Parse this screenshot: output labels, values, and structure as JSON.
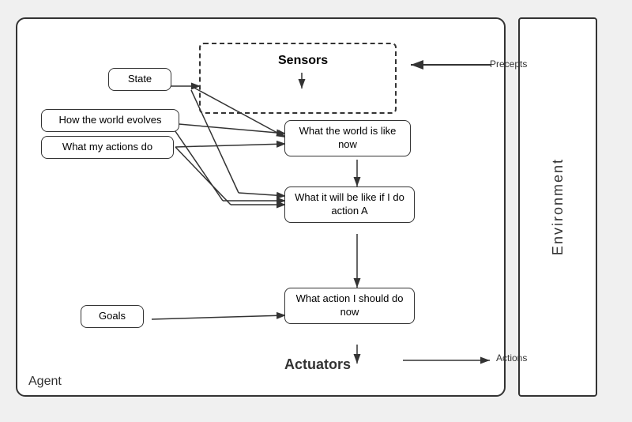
{
  "diagram": {
    "agent_label": "Agent",
    "environment_label": "Environment",
    "nodes": {
      "state": "State",
      "sensors": "Sensors",
      "world_now": "What the world\nis like now",
      "how_world_evolves": "How the world evolves",
      "what_actions_do": "What my actions do",
      "what_if": "What it will be like if\nI do action A",
      "goals": "Goals",
      "what_action": "What action I\nshould do now",
      "actuators": "Actuators"
    },
    "labels": {
      "precepts": "Precepts",
      "actions": "Actions"
    }
  }
}
